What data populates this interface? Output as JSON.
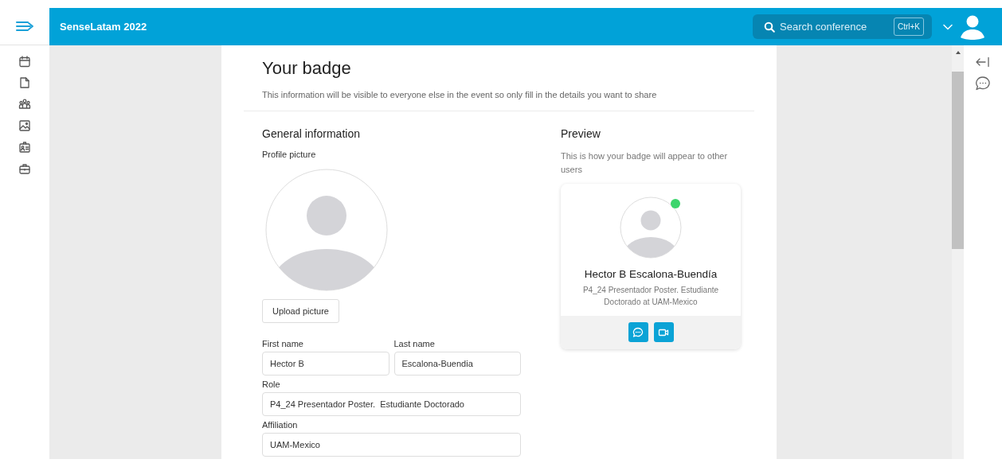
{
  "header": {
    "title": "SenseLatam 2022",
    "search": {
      "placeholder": "Search conference",
      "shortcut": "Ctrl+K"
    }
  },
  "sidebar": {
    "items": [
      {
        "kind": "calendar"
      },
      {
        "kind": "document"
      },
      {
        "kind": "people"
      },
      {
        "kind": "image"
      },
      {
        "kind": "badge"
      },
      {
        "kind": "briefcase"
      }
    ]
  },
  "page": {
    "title": "Your badge",
    "description": "This information will be visible to everyone else in the event so only fill in the details you want to share"
  },
  "general": {
    "heading": "General information",
    "profile_label": "Profile picture",
    "upload_button": "Upload picture",
    "fields": [
      {
        "label": "First name",
        "value": "Hector B",
        "kind": "half"
      },
      {
        "label": "Last name",
        "value": "Escalona-Buendia",
        "kind": "half"
      },
      {
        "label": "Role",
        "value": "P4_24 Presentador Poster.  Estudiante Doctorado",
        "kind": "full"
      },
      {
        "label": "Affiliation",
        "value": "UAM-Mexico",
        "kind": "full"
      }
    ]
  },
  "preview": {
    "heading": "Preview",
    "description": "This is how your badge will appear to other users",
    "card": {
      "name": "Hector B Escalona-Buendía",
      "details": "P4_24 Presentador Poster. Estudiante Doctorado at UAM-Mexico",
      "online": true,
      "actions": [
        {
          "kind": "chat"
        },
        {
          "kind": "video"
        }
      ]
    }
  },
  "right_rail": {
    "items": [
      {
        "kind": "collapse"
      },
      {
        "kind": "chat"
      }
    ]
  }
}
